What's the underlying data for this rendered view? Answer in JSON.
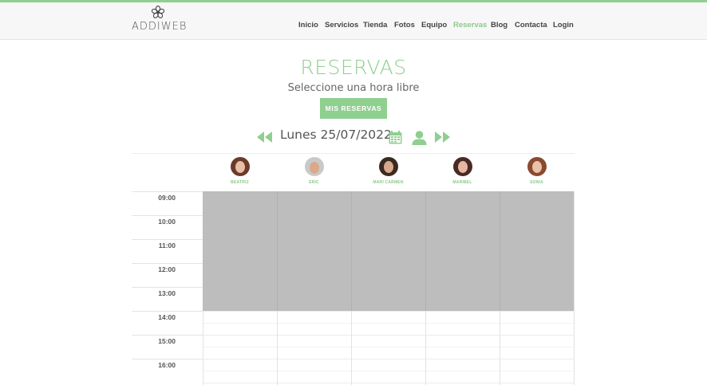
{
  "header": {
    "logo_text": "ADDIWEB",
    "nav": [
      {
        "label": "Inicio",
        "active": false
      },
      {
        "label": "Servicios",
        "active": false
      },
      {
        "label": "Tienda",
        "active": false
      },
      {
        "label": "Fotos",
        "active": false
      },
      {
        "label": "Equipo",
        "active": false
      },
      {
        "label": "Reservas",
        "active": true
      },
      {
        "label": "Blog",
        "active": false
      },
      {
        "label": "Contacta",
        "active": false
      },
      {
        "label": "Login",
        "active": false
      }
    ]
  },
  "main": {
    "title": "RESERVAS",
    "subtitle": "Seleccione una hora libre",
    "my_bookings_button": "MIS RESERVAS",
    "date": "Lunes 25/07/2022"
  },
  "icons": {
    "prev": "double-chevron-left-icon",
    "next": "double-chevron-right-icon",
    "calendar": "calendar-icon",
    "user": "user-icon"
  },
  "colors": {
    "accent": "#8fcf8f",
    "blocked": "#bdbdbd"
  },
  "staff": [
    {
      "name": "BEATRIZ"
    },
    {
      "name": "ERIC"
    },
    {
      "name": "MARI CARMEN"
    },
    {
      "name": "MARIBEL"
    },
    {
      "name": "SONIA"
    }
  ],
  "times": [
    "09:00",
    "10:00",
    "11:00",
    "12:00",
    "13:00",
    "14:00",
    "15:00",
    "16:00"
  ],
  "blocked_hours": [
    "09:00",
    "10:00",
    "11:00",
    "12:00",
    "13:00"
  ]
}
